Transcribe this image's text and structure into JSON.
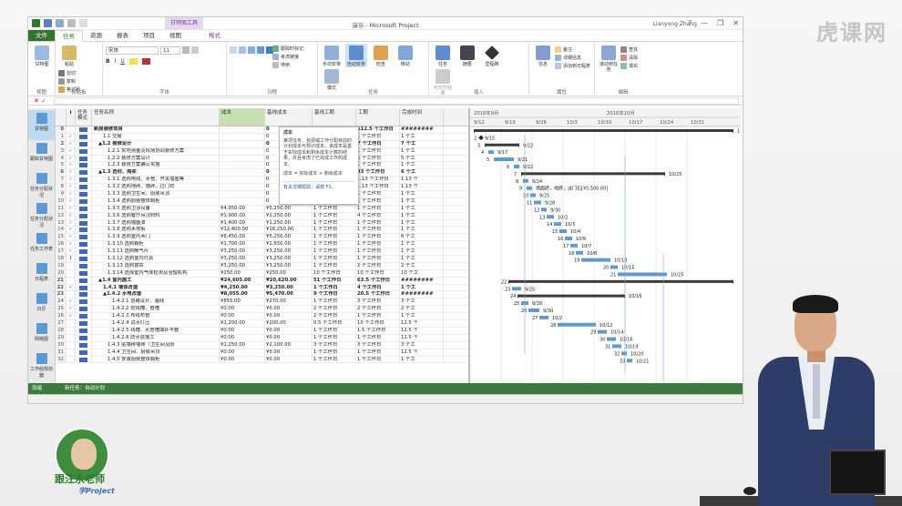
{
  "window": {
    "title": "演示 - Microsoft Project",
    "context_tab_group": "甘特图工具",
    "user": "Lianyong Zhang",
    "controls": [
      "?",
      "—",
      "❐",
      "✕"
    ]
  },
  "tabs": [
    "文件",
    "任务",
    "资源",
    "报表",
    "项目",
    "视图",
    "格式"
  ],
  "active_tab": "任务",
  "ribbon": {
    "view_group": {
      "label": "视图",
      "button": "甘特图"
    },
    "clipboard_group": {
      "label": "剪贴板",
      "paste": "粘贴",
      "cut": "剪切",
      "copy": "复制",
      "format_painter": "格式刷"
    },
    "font_group": {
      "label": "字体",
      "font_name": "宋体",
      "font_size": "11",
      "bold": "B",
      "italic": "I",
      "underline": "U"
    },
    "schedule_group": {
      "label": "日程",
      "mark_on_track": "跟踪时标记",
      "respect_links": "考虑链接",
      "inactivate": "停用"
    },
    "tasks_group": {
      "label": "任务",
      "manual": "手动安排",
      "auto": "自动安排",
      "inspect": "检查",
      "move": "移动",
      "mode": "模式"
    },
    "insert_group": {
      "label": "插入",
      "task": "任务",
      "summary": "摘要",
      "milestone": "里程碑",
      "deliverable": "可交付结果"
    },
    "properties_group": {
      "label": "属性",
      "info": "信息",
      "notes": "备注",
      "details": "详细信息",
      "add_to_timeline": "添加到日程表"
    },
    "editing_group": {
      "label": "编辑",
      "scroll_to_task": "滚动到任务",
      "find": "查找",
      "clear": "清除",
      "fill": "填充"
    }
  },
  "view_bar": [
    "甘特图",
    "跟踪甘特图",
    "任务分配状况",
    "任务分配状况",
    "任务工作表",
    "日程表",
    "日历",
    "网络图",
    "工作组规划器",
    "资源表"
  ],
  "columns": {
    "info": "ℹ",
    "mode": "任务模式",
    "name": "任务名称",
    "cost": "成本",
    "baseline_cost": "基线成本",
    "baseline_work": "基线工期",
    "work": "工期",
    "remaining": "完成时间"
  },
  "tooltip": {
    "title": "成本",
    "body": "某项任务、资源或工作分配目前的计划成本与预计成本，该成本是基于实际成本和剩余成本计算的结果，并且考虑了已完成工作的成本。",
    "formula": "成本 = 实际成本 + 剩余成本",
    "help": "有关详细帮助，请按 F1。"
  },
  "rows": [
    {
      "id": "0",
      "chk": "",
      "name": "新房装修项目",
      "indent": 0,
      "cost": "",
      "base": "0",
      "work": "97 个工作日",
      "bwork": "112.5 个工作日",
      "rem": "########",
      "sum": true
    },
    {
      "id": "1",
      "chk": "✓",
      "name": "1.1 交房",
      "indent": 2,
      "cost": "",
      "base": "0",
      "work": "0 个工作日",
      "bwork": "1 个工作日",
      "rem": "1 个工",
      "sum": false
    },
    {
      "id": "2",
      "chk": "✓",
      "name": "▲1.2 装修设计",
      "indent": 1,
      "cost": "",
      "base": "0",
      "work": "7 个工作日",
      "bwork": "7 个工作日",
      "rem": "7 个工",
      "sum": true
    },
    {
      "id": "3",
      "chk": "✓",
      "name": "1.2.1 实地测量及现场协调装修方案",
      "indent": 3,
      "cost": "",
      "base": "0",
      "work": "1 个工作日",
      "bwork": "1 个工作日",
      "rem": "1 个工",
      "sum": false
    },
    {
      "id": "4",
      "chk": "✓",
      "name": "1.2.2 装修方案设计",
      "indent": 3,
      "cost": "",
      "base": "0",
      "work": "5 个工作日",
      "bwork": "5 个工作日",
      "rem": "5 个工",
      "sum": false
    },
    {
      "id": "5",
      "chk": "✓",
      "name": "1.2.3 装修方案确认实施",
      "indent": 3,
      "cost": "",
      "base": "0",
      "work": "1 个工作日",
      "bwork": "1 个工作日",
      "rem": "1 个工",
      "sum": false
    },
    {
      "id": "6",
      "chk": "✓",
      "name": "▲1.3 选材、购买",
      "indent": 1,
      "cost": "",
      "base": "0",
      "work": "28 个工作日",
      "bwork": "33 个工作日",
      "rem": "6 个工",
      "sum": true
    },
    {
      "id": "7",
      "chk": "✓",
      "name": "1.3.1 选购电线、水管、开关插座等",
      "indent": 3,
      "cost": "",
      "base": "0",
      "work": "1 个工作日",
      "bwork": "1.13 个工作日",
      "rem": "1.13 个",
      "sum": false
    },
    {
      "id": "8",
      "chk": "✓",
      "name": "1.3.2 选购地砖、墙砖、过门石",
      "indent": 3,
      "cost": "",
      "base": "0",
      "work": "1 个工作日",
      "bwork": "1.13 个工作日",
      "rem": "1.13 个",
      "sum": false
    },
    {
      "id": "9",
      "chk": "✓",
      "name": "1.3.3 选购卫生间、厨房吊顶",
      "indent": 3,
      "cost": "",
      "base": "0",
      "work": "1 个工作日",
      "bwork": "1 个工作日",
      "rem": "1 个工",
      "sum": false
    },
    {
      "id": "10",
      "chk": "✓",
      "name": "1.3.4 选购厨房整体橱柜",
      "indent": 3,
      "cost": "",
      "base": "0",
      "work": "1 个工作日",
      "bwork": "1 个工作日",
      "rem": "1 个工",
      "sum": false
    },
    {
      "id": "11",
      "chk": "✓",
      "name": "1.3.5 选购卫浴设备",
      "indent": 3,
      "cost": "¥4,950.00",
      "base": "¥5,250.00",
      "work": "1 个工作日",
      "bwork": "1 个工作日",
      "rem": "1 个工",
      "sum": false
    },
    {
      "id": "12",
      "chk": "✓",
      "name": "1.3.6 选购客厅吊顶材料",
      "indent": 3,
      "cost": "¥1,900.00",
      "base": "¥2,250.00",
      "work": "1 个工作日",
      "bwork": "4 个工作日",
      "rem": "1 个工",
      "sum": false
    },
    {
      "id": "13",
      "chk": "✓",
      "name": "1.3.7 选购墙面漆",
      "indent": 3,
      "cost": "¥1,400.00",
      "base": "¥1,250.00",
      "work": "1 个工作日",
      "bwork": "1 个工作日",
      "rem": "1 个工",
      "sum": false
    },
    {
      "id": "14",
      "chk": "✓",
      "name": "1.3.8 选购木地板",
      "indent": 3,
      "cost": "¥12,400.00",
      "base": "¥16,250.00",
      "work": "1 个工作日",
      "bwork": "1 个工作日",
      "rem": "1 个工",
      "sum": false
    },
    {
      "id": "15",
      "chk": "✓",
      "name": "1.3.9 选购室内木门",
      "indent": 3,
      "cost": "¥8,450.00",
      "base": "¥5,250.00",
      "work": "1 个工作日",
      "bwork": "1 个工作日",
      "rem": "6 个工",
      "sum": false
    },
    {
      "id": "16",
      "chk": "✓",
      "name": "1.3.10 选购橱柜",
      "indent": 3,
      "cost": "¥1,700.00",
      "base": "¥1,650.00",
      "work": "1 个工作日",
      "bwork": "1 个工作日",
      "rem": "1 个工",
      "sum": false
    },
    {
      "id": "17",
      "chk": "✓",
      "name": "1.3.11 选购暖气片",
      "indent": 3,
      "cost": "¥3,250.00",
      "base": "¥3,250.00",
      "work": "1 个工作日",
      "bwork": "1 个工作日",
      "rem": "1 个工",
      "sum": false
    },
    {
      "id": "18",
      "chk": "!",
      "name": "1.3.12 选购室内灯具",
      "indent": 3,
      "cost": "¥3,250.00",
      "base": "¥3,250.00",
      "work": "1 个工作日",
      "bwork": "1 个工作日",
      "rem": "1 个工",
      "sum": false
    },
    {
      "id": "19",
      "chk": "",
      "name": "1.3.13 选购窗帘",
      "indent": 3,
      "cost": "¥3,250.00",
      "base": "¥3,250.00",
      "work": "1 个工作日",
      "bwork": "2 个工作日",
      "rem": "2 个工",
      "sum": false
    },
    {
      "id": "20",
      "chk": "",
      "name": "1.3.14 选择室内气体检测及治理机构",
      "indent": 3,
      "cost": "¥250.00",
      "base": "¥250.00",
      "work": "10 个工作日",
      "bwork": "10 个工作日",
      "rem": "10 个工",
      "sum": false
    },
    {
      "id": "21",
      "chk": "",
      "name": "▲1.4 室内施工",
      "indent": 1,
      "cost": "¥24,605.00",
      "base": "¥20,620.00",
      "work": "51 个工作日",
      "bwork": "63.5 个工作日",
      "rem": "########",
      "sum": true
    },
    {
      "id": "22",
      "chk": "✓",
      "name": "1.4.1 墙体改造",
      "indent": 2,
      "cost": "¥4,250.00",
      "base": "¥3,250.00",
      "work": "1 个工作日",
      "bwork": "4 个工作日",
      "rem": "1 个工",
      "sum": true
    },
    {
      "id": "23",
      "chk": "",
      "name": "▲1.4.2 水电改造",
      "indent": 2,
      "cost": "¥8,055.00",
      "base": "¥5,470.00",
      "work": "9 个工作日",
      "bwork": "20.5 个工作日",
      "rem": "########",
      "sum": true
    },
    {
      "id": "24",
      "chk": "✓",
      "name": "1.4.2.1 冒路设计、画线",
      "indent": 4,
      "cost": "¥855.00",
      "base": "¥270.00",
      "work": "1 个工作日",
      "bwork": "3 个工作日",
      "rem": "3 个工",
      "sum": false
    },
    {
      "id": "25",
      "chk": "✓",
      "name": "1.4.2.2 挖线槽、管槽",
      "indent": 4,
      "cost": "¥0.00",
      "base": "¥0.00",
      "work": "2 个工作日",
      "bwork": "2 个工作日",
      "rem": "2 个工",
      "sum": false
    },
    {
      "id": "26",
      "chk": "✓",
      "name": "1.4.2.3 布线布管",
      "indent": 4,
      "cost": "¥0.00",
      "base": "¥0.00",
      "work": "2 个工作日",
      "bwork": "1 个工作日",
      "rem": "1 个工",
      "sum": false
    },
    {
      "id": "27",
      "chk": "",
      "name": "1.4.2.4 试水打压",
      "indent": 4,
      "cost": "¥2,200.00",
      "base": "¥200.00",
      "work": "0.5 个工作日",
      "bwork": "10 个工作日",
      "rem": "12.5 个",
      "sum": false
    },
    {
      "id": "28",
      "chk": "",
      "name": "1.4.2.5 线槽、水管槽填补平整",
      "indent": 4,
      "cost": "¥0.00",
      "base": "¥0.00",
      "work": "1 个工作日",
      "bwork": "1.5 个工作日",
      "rem": "12.5 个",
      "sum": false
    },
    {
      "id": "29",
      "chk": "",
      "name": "1.4.2.6 防水层施工",
      "indent": 4,
      "cost": "¥0.00",
      "base": "¥0.00",
      "work": "1 个工作日",
      "bwork": "1 个工作日",
      "rem": "12.5 个",
      "sum": false
    },
    {
      "id": "30",
      "chk": "",
      "name": "1.4.3 贴墙砖墙砖（卫生间及厨",
      "indent": 3,
      "cost": "¥2,250.00",
      "base": "¥2,100.00",
      "work": "3 个工作日",
      "bwork": "3 个工作日",
      "rem": "3 个工",
      "sum": false
    },
    {
      "id": "31",
      "chk": "",
      "name": "1.4.4 卫生间、厨房吊顶",
      "indent": 3,
      "cost": "¥0.00",
      "base": "¥0.00",
      "work": "1 个工作日",
      "bwork": "1 个工作日",
      "rem": "12.5 个",
      "sum": false
    },
    {
      "id": "32",
      "chk": "",
      "name": "1.4.5 安装厨房整体橱柜",
      "indent": 3,
      "cost": "¥0.00",
      "base": "¥0.00",
      "work": "1 个工作日",
      "bwork": "1 个工作日",
      "rem": "1 个工",
      "sum": false
    }
  ],
  "gantt": {
    "months": [
      "2016年9月",
      "2016年10月"
    ],
    "weeks": [
      "9/12",
      "9/19",
      "9/26",
      "10/3",
      "10/10",
      "10/17",
      "10/24",
      "10/31"
    ],
    "bars": [
      {
        "row": 0,
        "start": 0,
        "end": 285,
        "type": "summary",
        "label": "1"
      },
      {
        "row": 1,
        "start": 8,
        "end": 8,
        "type": "milestone",
        "label": "9/15",
        "num": "2"
      },
      {
        "row": 2,
        "start": 12,
        "end": 50,
        "type": "summary",
        "label": "9/22",
        "num": "3"
      },
      {
        "row": 3,
        "start": 16,
        "end": 22,
        "type": "task",
        "label": "9/17",
        "num": "4"
      },
      {
        "row": 4,
        "start": 22,
        "end": 44,
        "type": "task",
        "label": "9/21",
        "num": "5"
      },
      {
        "row": 5,
        "start": 44,
        "end": 50,
        "type": "task",
        "label": "9/22",
        "num": "6"
      },
      {
        "row": 6,
        "start": 52,
        "end": 210,
        "type": "summary",
        "label": "10/25",
        "num": "7"
      },
      {
        "row": 7,
        "start": 54,
        "end": 60,
        "type": "task",
        "label": "9/24",
        "num": "8"
      },
      {
        "row": 8,
        "start": 58,
        "end": 64,
        "type": "task",
        "label": "墙面砖，地砖，过门石[¥5,500.00]",
        "num": "9"
      },
      {
        "row": 9,
        "start": 62,
        "end": 68,
        "type": "task",
        "label": "9/25",
        "num": "10"
      },
      {
        "row": 10,
        "start": 66,
        "end": 74,
        "type": "task",
        "label": "9/28",
        "num": "11"
      },
      {
        "row": 11,
        "start": 74,
        "end": 80,
        "type": "task",
        "label": "9/30",
        "num": "12"
      },
      {
        "row": 12,
        "start": 80,
        "end": 88,
        "type": "task",
        "label": "10/2",
        "num": "13"
      },
      {
        "row": 13,
        "start": 88,
        "end": 96,
        "type": "task",
        "label": "10/3",
        "num": "14"
      },
      {
        "row": 14,
        "start": 94,
        "end": 102,
        "type": "task",
        "label": "10/4",
        "num": "15"
      },
      {
        "row": 15,
        "start": 100,
        "end": 108,
        "type": "task",
        "label": "10/6",
        "num": "16"
      },
      {
        "row": 16,
        "start": 106,
        "end": 114,
        "type": "task",
        "label": "10/7",
        "num": "17"
      },
      {
        "row": 17,
        "start": 112,
        "end": 120,
        "type": "task",
        "label": "10/8",
        "num": "18"
      },
      {
        "row": 18,
        "start": 118,
        "end": 150,
        "type": "task",
        "label": "10/13",
        "num": "19"
      },
      {
        "row": 19,
        "start": 150,
        "end": 158,
        "type": "task",
        "label": "10/15",
        "num": "20"
      },
      {
        "row": 20,
        "start": 158,
        "end": 212,
        "type": "task",
        "label": "10/25",
        "num": "21"
      },
      {
        "row": 21,
        "start": 38,
        "end": 285,
        "type": "summary",
        "label": "",
        "num": "22"
      },
      {
        "row": 22,
        "start": 42,
        "end": 52,
        "type": "task",
        "label": "9/25",
        "num": "23"
      },
      {
        "row": 23,
        "start": 48,
        "end": 166,
        "type": "summary",
        "label": "10/16",
        "num": "24"
      },
      {
        "row": 24,
        "start": 52,
        "end": 60,
        "type": "task",
        "label": "9/28",
        "num": "25"
      },
      {
        "row": 25,
        "start": 60,
        "end": 72,
        "type": "task",
        "label": "9/30",
        "num": "26"
      },
      {
        "row": 26,
        "start": 72,
        "end": 82,
        "type": "task",
        "label": "10/2",
        "num": "27"
      },
      {
        "row": 27,
        "start": 92,
        "end": 134,
        "type": "task",
        "label": "10/12",
        "num": "28"
      },
      {
        "row": 28,
        "start": 136,
        "end": 146,
        "type": "task",
        "label": "10/14",
        "num": "29"
      },
      {
        "row": 29,
        "start": 146,
        "end": 156,
        "type": "task",
        "label": "10/16",
        "num": "30"
      },
      {
        "row": 30,
        "start": 152,
        "end": 162,
        "type": "task",
        "label": "10/19",
        "num": "31"
      },
      {
        "row": 31,
        "start": 162,
        "end": 168,
        "type": "task",
        "label": "10/20",
        "num": "32"
      },
      {
        "row": 32,
        "start": 168,
        "end": 174,
        "type": "task",
        "label": "10/21",
        "num": "33"
      }
    ]
  },
  "status": {
    "ready": "就绪",
    "mode": "新任务：自动计划"
  },
  "watermark": "虎课网",
  "logo": {
    "line1": "跟汪永老师",
    "line2": "学Project"
  },
  "colors": {
    "file_tab": "#31752f",
    "accent": "#3b7b3b",
    "bar": "#5b9bd5",
    "summary": "#3a3a3a",
    "selected_col": "#c6e0b4"
  }
}
